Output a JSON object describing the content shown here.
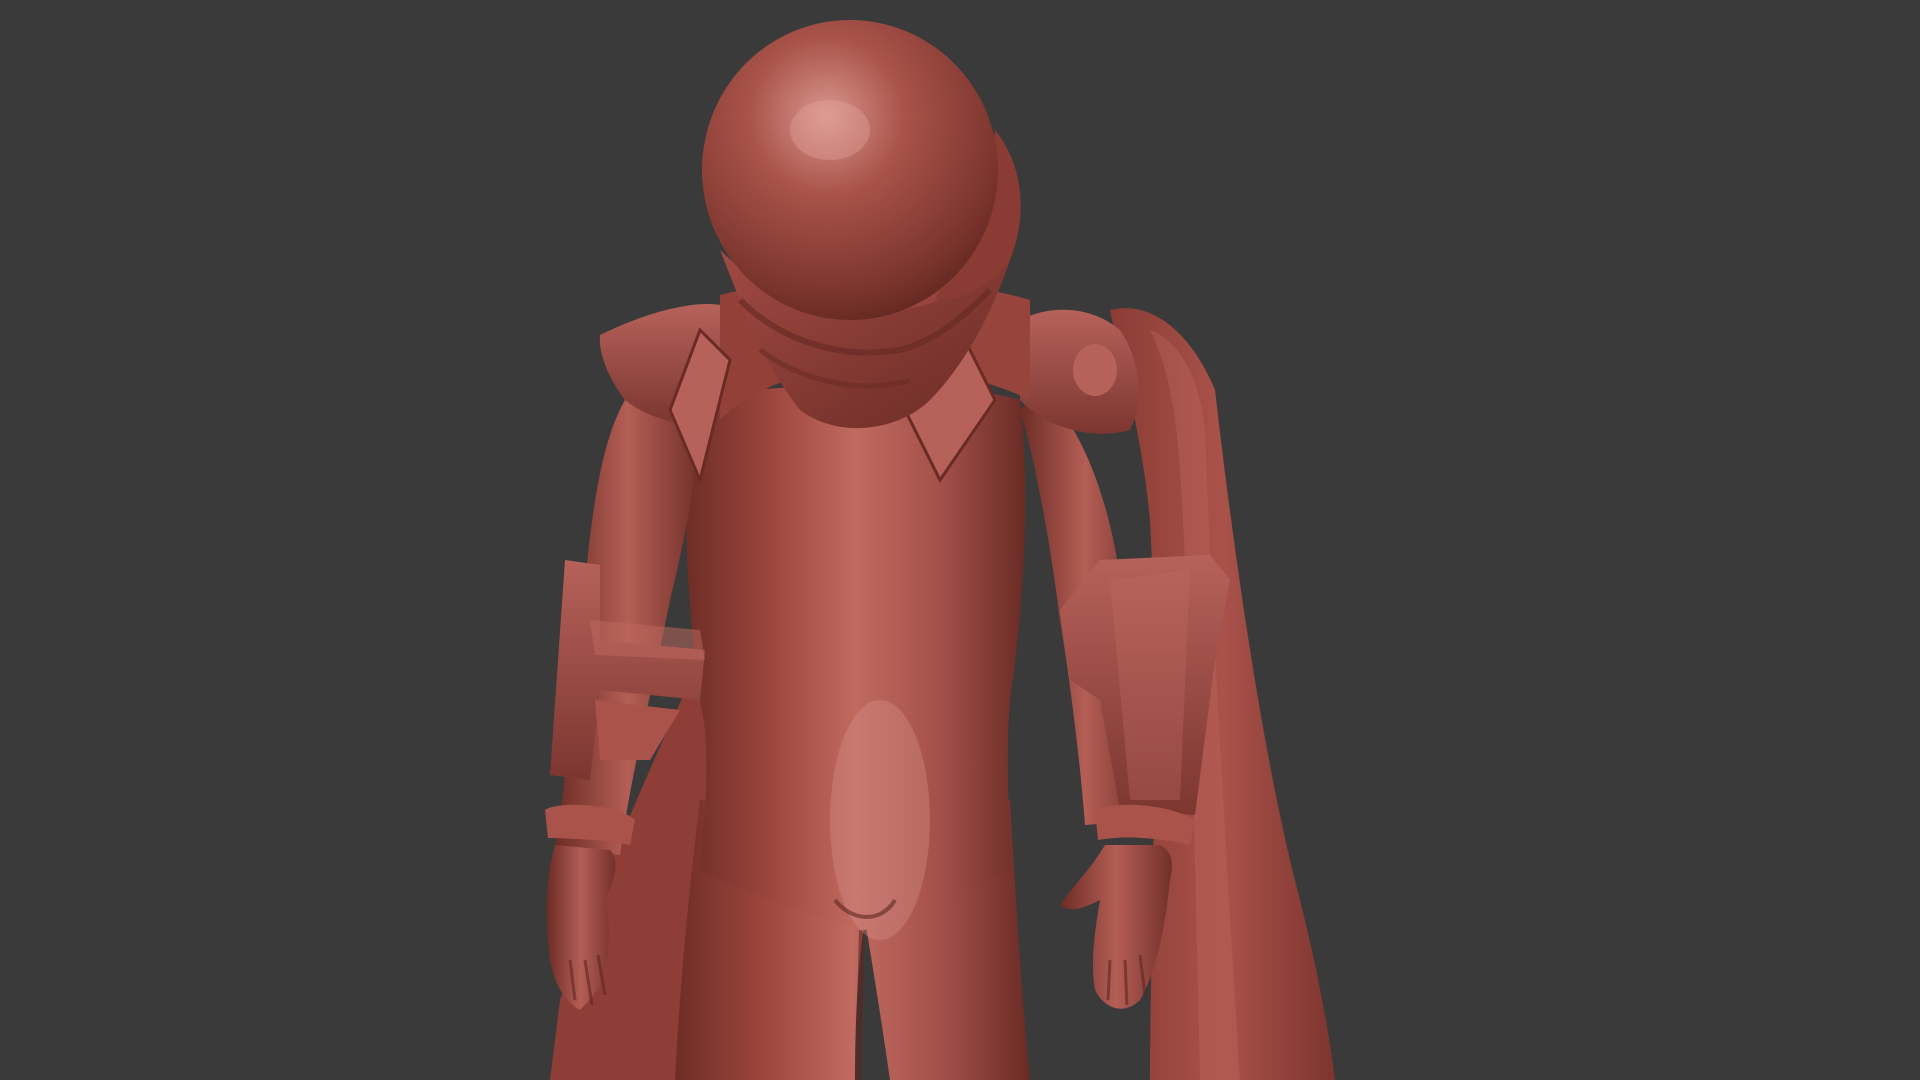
{
  "viewport": {
    "background_color": "#3a3a3a",
    "model": {
      "material_color": "#a24a40",
      "material_shadow": "#5e2620",
      "material_highlight": "#d58a80"
    }
  }
}
